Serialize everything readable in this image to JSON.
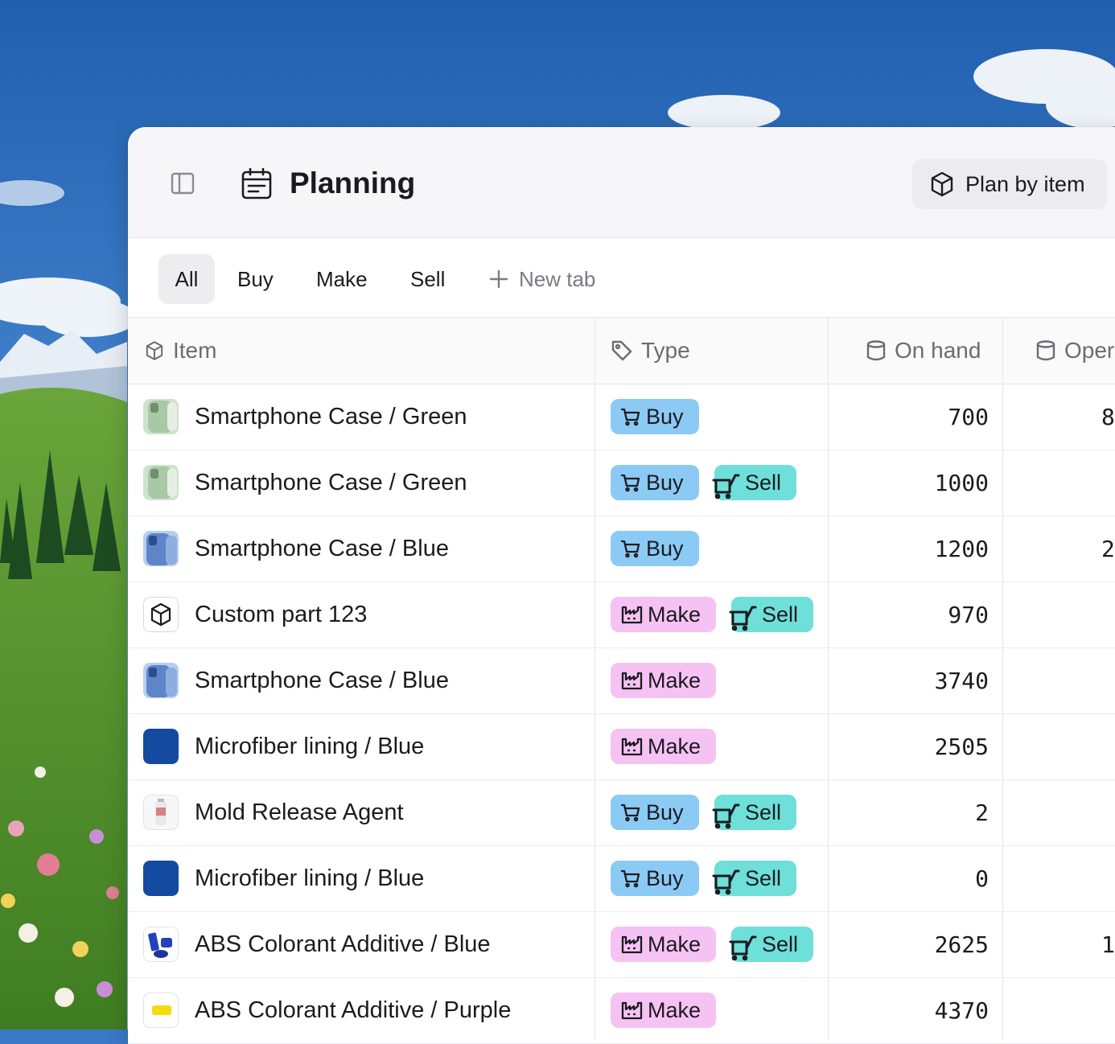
{
  "colors": {
    "buy": "#8ccaf6",
    "sell": "#6edfd9",
    "make": "#f6c2f4",
    "tab_active": "#ededf0"
  },
  "header": {
    "title": "Planning",
    "title_icon": "calendar-icon",
    "sidebar_toggle_icon": "sidebar-toggle-icon",
    "plan_button": {
      "label": "Plan by item",
      "icon": "cube-icon"
    }
  },
  "tabs": {
    "items": [
      {
        "label": "All",
        "active": true
      },
      {
        "label": "Buy"
      },
      {
        "label": "Make"
      },
      {
        "label": "Sell"
      }
    ],
    "new_tab_label": "New tab"
  },
  "table": {
    "columns": {
      "item": "Item",
      "type": "Type",
      "on_hand": "On hand",
      "open": "Oper"
    },
    "rows": [
      {
        "name": "Smartphone Case / Green",
        "thumb": "green-case",
        "types": [
          "Buy"
        ],
        "on_hand": "700",
        "open": "8"
      },
      {
        "name": "Smartphone Case / Green",
        "thumb": "green-case",
        "types": [
          "Buy",
          "Sell"
        ],
        "on_hand": "1000",
        "open": ""
      },
      {
        "name": "Smartphone Case / Blue",
        "thumb": "blue-case",
        "types": [
          "Buy"
        ],
        "on_hand": "1200",
        "open": "2"
      },
      {
        "name": "Custom part 123",
        "thumb": "cube",
        "types": [
          "Make",
          "Sell"
        ],
        "on_hand": "970",
        "open": ""
      },
      {
        "name": "Smartphone Case / Blue",
        "thumb": "blue-case",
        "types": [
          "Make"
        ],
        "on_hand": "3740",
        "open": ""
      },
      {
        "name": "Microfiber lining / Blue",
        "thumb": "blue-square",
        "types": [
          "Make"
        ],
        "on_hand": "2505",
        "open": ""
      },
      {
        "name": "Mold Release Agent",
        "thumb": "bottle",
        "types": [
          "Buy",
          "Sell"
        ],
        "on_hand": "2",
        "open": ""
      },
      {
        "name": "Microfiber lining / Blue",
        "thumb": "blue-square",
        "types": [
          "Buy",
          "Sell"
        ],
        "on_hand": "0",
        "open": ""
      },
      {
        "name": "ABS Colorant Additive / Blue",
        "thumb": "blue-pellets",
        "types": [
          "Make",
          "Sell"
        ],
        "on_hand": "2625",
        "open": "1"
      },
      {
        "name": "ABS Colorant Additive / Purple",
        "thumb": "yellow-pellet",
        "types": [
          "Make"
        ],
        "on_hand": "4370",
        "open": ""
      }
    ]
  }
}
